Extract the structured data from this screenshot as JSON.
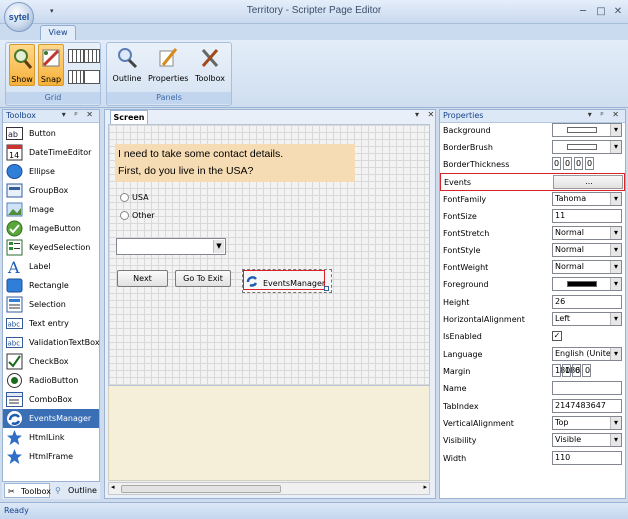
{
  "app": {
    "orb_label": "sytel",
    "window_title": "Territory - Scripter Page Editor",
    "controls": {
      "minimize": "─",
      "maximize": "□",
      "close": "✕"
    },
    "qat_arrow": "▾"
  },
  "ribbon": {
    "tabs": [
      {
        "label": "View"
      }
    ],
    "groups": {
      "grid": {
        "label": "Grid",
        "show_label": "Show",
        "snap_label": "Snap"
      },
      "panels": {
        "label": "Panels",
        "outline_label": "Outline",
        "properties_label": "Properties",
        "toolbox_label": "Toolbox"
      }
    }
  },
  "toolbox": {
    "title": "Toolbox",
    "controls": "▾ ᵖ ✕",
    "items": [
      {
        "label": "Button",
        "icon": "button-icon"
      },
      {
        "label": "DateTimeEditor",
        "icon": "calendar-icon"
      },
      {
        "label": "Ellipse",
        "icon": "ellipse-icon"
      },
      {
        "label": "GroupBox",
        "icon": "groupbox-icon"
      },
      {
        "label": "Image",
        "icon": "image-icon"
      },
      {
        "label": "ImageButton",
        "icon": "image-button-icon"
      },
      {
        "label": "KeyedSelection",
        "icon": "keyed-selection-icon"
      },
      {
        "label": "Label",
        "icon": "label-icon"
      },
      {
        "label": "Rectangle",
        "icon": "rectangle-icon"
      },
      {
        "label": "Selection",
        "icon": "selection-icon"
      },
      {
        "label": "Text entry",
        "icon": "text-entry-icon"
      },
      {
        "label": "ValidationTextBox",
        "icon": "validation-textbox-icon"
      },
      {
        "label": "CheckBox",
        "icon": "checkbox-icon"
      },
      {
        "label": "RadioButton",
        "icon": "radio-button-icon"
      },
      {
        "label": "ComboBox",
        "icon": "combobox-icon"
      },
      {
        "label": "EventsManager",
        "icon": "events-manager-icon"
      },
      {
        "label": "HtmlLink",
        "icon": "star-icon"
      },
      {
        "label": "HtmlFrame",
        "icon": "star-icon"
      }
    ],
    "bottom_tabs": [
      {
        "label": "Toolbox"
      },
      {
        "label": "Outline"
      }
    ]
  },
  "screen": {
    "tab_label": "Screen",
    "controls": "▾ ✕",
    "question_line1": "I need to take some contact details.",
    "question_line2": "First, do you live in the USA?",
    "radio_options": [
      {
        "label": "USA"
      },
      {
        "label": "Other"
      }
    ],
    "combo_value": "",
    "next_button": "Next",
    "exit_button": "Go To Exit",
    "events_manager_label": "EventsManager"
  },
  "properties": {
    "title": "Properties",
    "controls": "▾ ᵖ ✕",
    "rows": {
      "background": {
        "name": "Background"
      },
      "borderbrush": {
        "name": "BorderBrush"
      },
      "borderthickness": {
        "name": "BorderThickness",
        "values": [
          "0",
          "0",
          "0",
          "0"
        ]
      },
      "events": {
        "name": "Events",
        "value": "..."
      },
      "fontfamily": {
        "name": "FontFamily",
        "value": "Tahoma"
      },
      "fontsize": {
        "name": "FontSize",
        "value": "11"
      },
      "fontstretch": {
        "name": "FontStretch",
        "value": "Normal"
      },
      "fontstyle": {
        "name": "FontStyle",
        "value": "Normal"
      },
      "fontweight": {
        "name": "FontWeight",
        "value": "Normal"
      },
      "foreground": {
        "name": "Foreground"
      },
      "height": {
        "name": "Height",
        "value": "26"
      },
      "horizontalalignment": {
        "name": "HorizontalAlignment",
        "value": "Left"
      },
      "isenabled": {
        "name": "IsEnabled",
        "value": "✓"
      },
      "language": {
        "name": "Language",
        "value": "English (Unite"
      },
      "margin": {
        "name": "Margin",
        "values": [
          "180",
          "186",
          "0",
          "0"
        ]
      },
      "name": {
        "name": "Name",
        "value": ""
      },
      "tabindex": {
        "name": "TabIndex",
        "value": "2147483647"
      },
      "verticalalignment": {
        "name": "VerticalAlignment",
        "value": "Top"
      },
      "visibility": {
        "name": "Visibility",
        "value": "Visible"
      },
      "width": {
        "name": "Width",
        "value": "110"
      }
    }
  },
  "status": {
    "text": "Ready"
  },
  "colors": {
    "selection": "#3a6fb5",
    "highlight_border": "#d9232a",
    "question_bg": "#f6dcb4",
    "ribbon_active": "#f7b13a"
  }
}
